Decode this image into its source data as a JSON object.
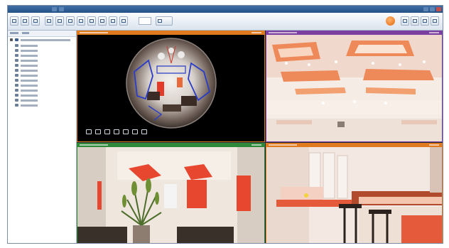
{
  "window": {
    "title": ""
  },
  "colors": {
    "title_bar": "#2f5f96",
    "alarm_button": "#e8731a",
    "camera_1_bar": "#e07a1f",
    "camera_2_bar": "#7a3fa0",
    "camera_3_bar": "#2e8a3a",
    "camera_4_bar": "#e07a1f"
  },
  "toolbar": {
    "icons": [
      "layout-1x1-icon",
      "layout-2x2-icon",
      "layout-3x3-icon",
      "layout-4x4-icon",
      "fullscreen-icon",
      "record-icon",
      "snapshot-icon",
      "playback-icon",
      "settings-icon",
      "save-icon",
      "stop-icon"
    ],
    "right_icons": [
      "alarm-icon",
      "config-icon",
      "log-icon",
      "user-icon",
      "help-icon"
    ]
  },
  "sidebar": {
    "tabs": [
      "",
      ""
    ],
    "tree": {
      "root": {
        "label": ""
      },
      "cameras": [
        {
          "label": ""
        },
        {
          "label": ""
        },
        {
          "label": ""
        },
        {
          "label": ""
        },
        {
          "label": ""
        },
        {
          "label": ""
        },
        {
          "label": ""
        },
        {
          "label": ""
        },
        {
          "label": ""
        },
        {
          "label": ""
        },
        {
          "label": ""
        },
        {
          "label": ""
        },
        {
          "label": ""
        }
      ]
    }
  },
  "cameras": [
    {
      "label": "",
      "timestamp": "",
      "view": "fisheye-lobby"
    },
    {
      "label": "",
      "timestamp": "",
      "view": "ceiling-lights"
    },
    {
      "label": "",
      "timestamp": "",
      "view": "lobby-plants"
    },
    {
      "label": "",
      "timestamp": "",
      "view": "bar-counter"
    }
  ],
  "fisheye_controls": [
    "dewarp-icon",
    "pan-icon",
    "zoom-icon",
    "rotate-icon",
    "ptz-icon",
    "snapshot-icon",
    "close-icon"
  ]
}
